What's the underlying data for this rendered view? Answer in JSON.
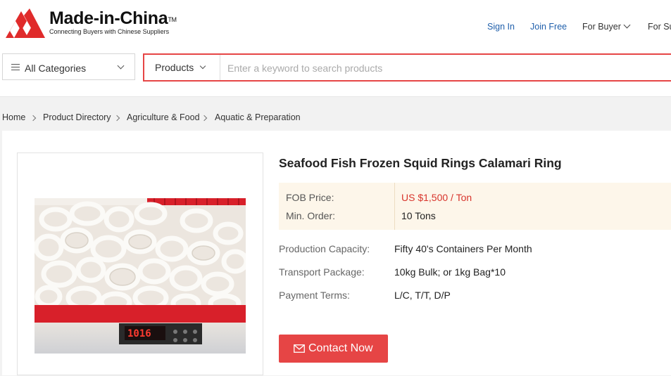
{
  "header": {
    "logo_title": "Made-in-China",
    "logo_tm": "TM",
    "logo_tagline": "Connecting Buyers with Chinese Suppliers",
    "links": [
      {
        "label": "Sign In"
      },
      {
        "label": "Join Free"
      },
      {
        "label": "For Buyer"
      },
      {
        "label": "For Su"
      }
    ]
  },
  "search": {
    "categories_label": "All Categories",
    "type_label": "Products",
    "placeholder": "Enter a keyword to search products",
    "value": ""
  },
  "breadcrumb": [
    "Home",
    "Product Directory",
    "Agriculture & Food",
    "Aquatic & Preparation"
  ],
  "product": {
    "title": "Seafood Fish Frozen Squid Rings Calamari Ring",
    "price_label": "FOB Price:",
    "price_value": "US $1,500 / Ton",
    "min_order_label": "Min. Order:",
    "min_order_value": "10 Tons",
    "attributes": [
      {
        "label": "Production Capacity:",
        "value": "Fifty 40's Containers Per Month"
      },
      {
        "label": "Transport Package:",
        "value": "10kg Bulk; or 1kg Bag*10"
      },
      {
        "label": "Payment Terms:",
        "value": "L/C, T/T, D/P"
      }
    ],
    "contact_label": "Contact Now",
    "scale_readout": "1016"
  },
  "icons": [
    "made-in-china-logo-icon",
    "menu-icon",
    "chevron-down-icon",
    "mail-icon"
  ],
  "colors": {
    "brand_red": "#e64545",
    "price_red": "#d8342c",
    "link_blue": "#1f5fab",
    "price_bg": "#fdf6ea"
  }
}
